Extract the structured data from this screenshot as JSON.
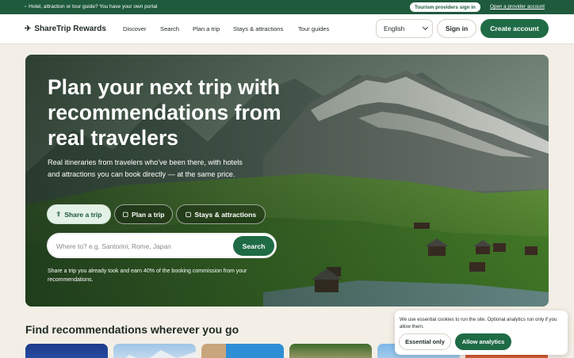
{
  "promo": {
    "icon": "store-icon",
    "message": "Hotel, attraction or tour guide? You have your own portal",
    "providers_sign_in": "Tourism providers sign in",
    "open_account": "Open a provider account"
  },
  "nav": {
    "logo_icon": "plane-icon",
    "logo": "ShareTrip Rewards",
    "links": [
      "Discover",
      "Search",
      "Plan a trip",
      "Stays & attractions",
      "Tour guides"
    ],
    "language": "English",
    "sign_in": "Sign in",
    "create_account": "Create account"
  },
  "hero": {
    "title": "Plan your next trip with recommendations from real travelers",
    "subtitle": "Real itineraries from travelers who've been there, with hotels and attractions you can book directly — at the same price.",
    "tabs": [
      {
        "label": "Share a trip",
        "icon": "share-icon",
        "active": true
      },
      {
        "label": "Plan a trip",
        "icon": "map-icon",
        "active": false
      },
      {
        "label": "Stays & attractions",
        "icon": "bed-icon",
        "active": false
      }
    ],
    "search_placeholder": "Where to? e.g. Santorini, Rome, Japan",
    "search_button": "Search",
    "note": "Share a trip you already took and earn 40% of the booking commission from your recommendations."
  },
  "section": {
    "title": "Find recommendations wherever you go"
  },
  "cookie": {
    "text": "We use essential cookies to run the site. Optional analytics run only if you allow them.",
    "essential": "Essential only",
    "allow": "Allow analytics"
  },
  "colors": {
    "brand_green": "#1f6b45",
    "promo_bar": "#1f5a3d",
    "page_bg": "#f3efe6"
  }
}
